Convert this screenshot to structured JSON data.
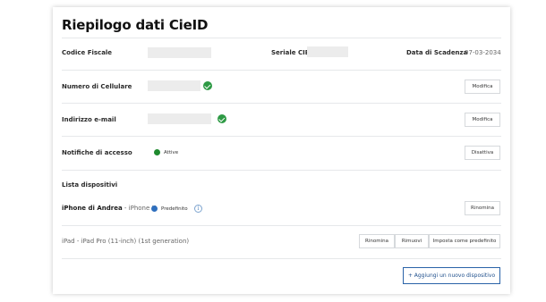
{
  "title": "Riepilogo dati CieID",
  "fields": {
    "fiscal_code_label": "Codice Fiscale",
    "serial_label": "Seriale CIE",
    "expiry_label": "Data di Scadenza",
    "expiry_value": "07-03-2034",
    "phone_label": "Numero di Cellulare",
    "email_label": "Indirizzo e-mail",
    "notifications_label": "Notifiche di accesso",
    "notifications_status": "Attive"
  },
  "buttons": {
    "modify_phone": "Modifica",
    "modify_email": "Modifica",
    "disable_notifications": "Disattiva"
  },
  "devices": {
    "section_label": "Lista dispositivi",
    "items": [
      {
        "name": "iPhone di Andrea",
        "separator": " - ",
        "model": "iPhone X",
        "badge": "Predefinito",
        "actions": [
          "Rinomina"
        ]
      },
      {
        "name": "iPad",
        "separator": " - ",
        "model": "iPad Pro (11-inch) (1st generation)",
        "actions": [
          "Rinomina",
          "Rimuovi",
          "Imposta come predefinito"
        ]
      }
    ],
    "add_button": "+ Aggiungi un nuovo dispositivo"
  },
  "icons": {
    "verified": "check-circle-icon",
    "status_active": "status-dot",
    "default_device": "status-dot",
    "info": "info-icon"
  },
  "colors": {
    "verified_green": "#2e9a45",
    "active_green": "#1f8a2e",
    "default_blue": "#2f6fbe",
    "primary_blue": "#2a63a8"
  }
}
